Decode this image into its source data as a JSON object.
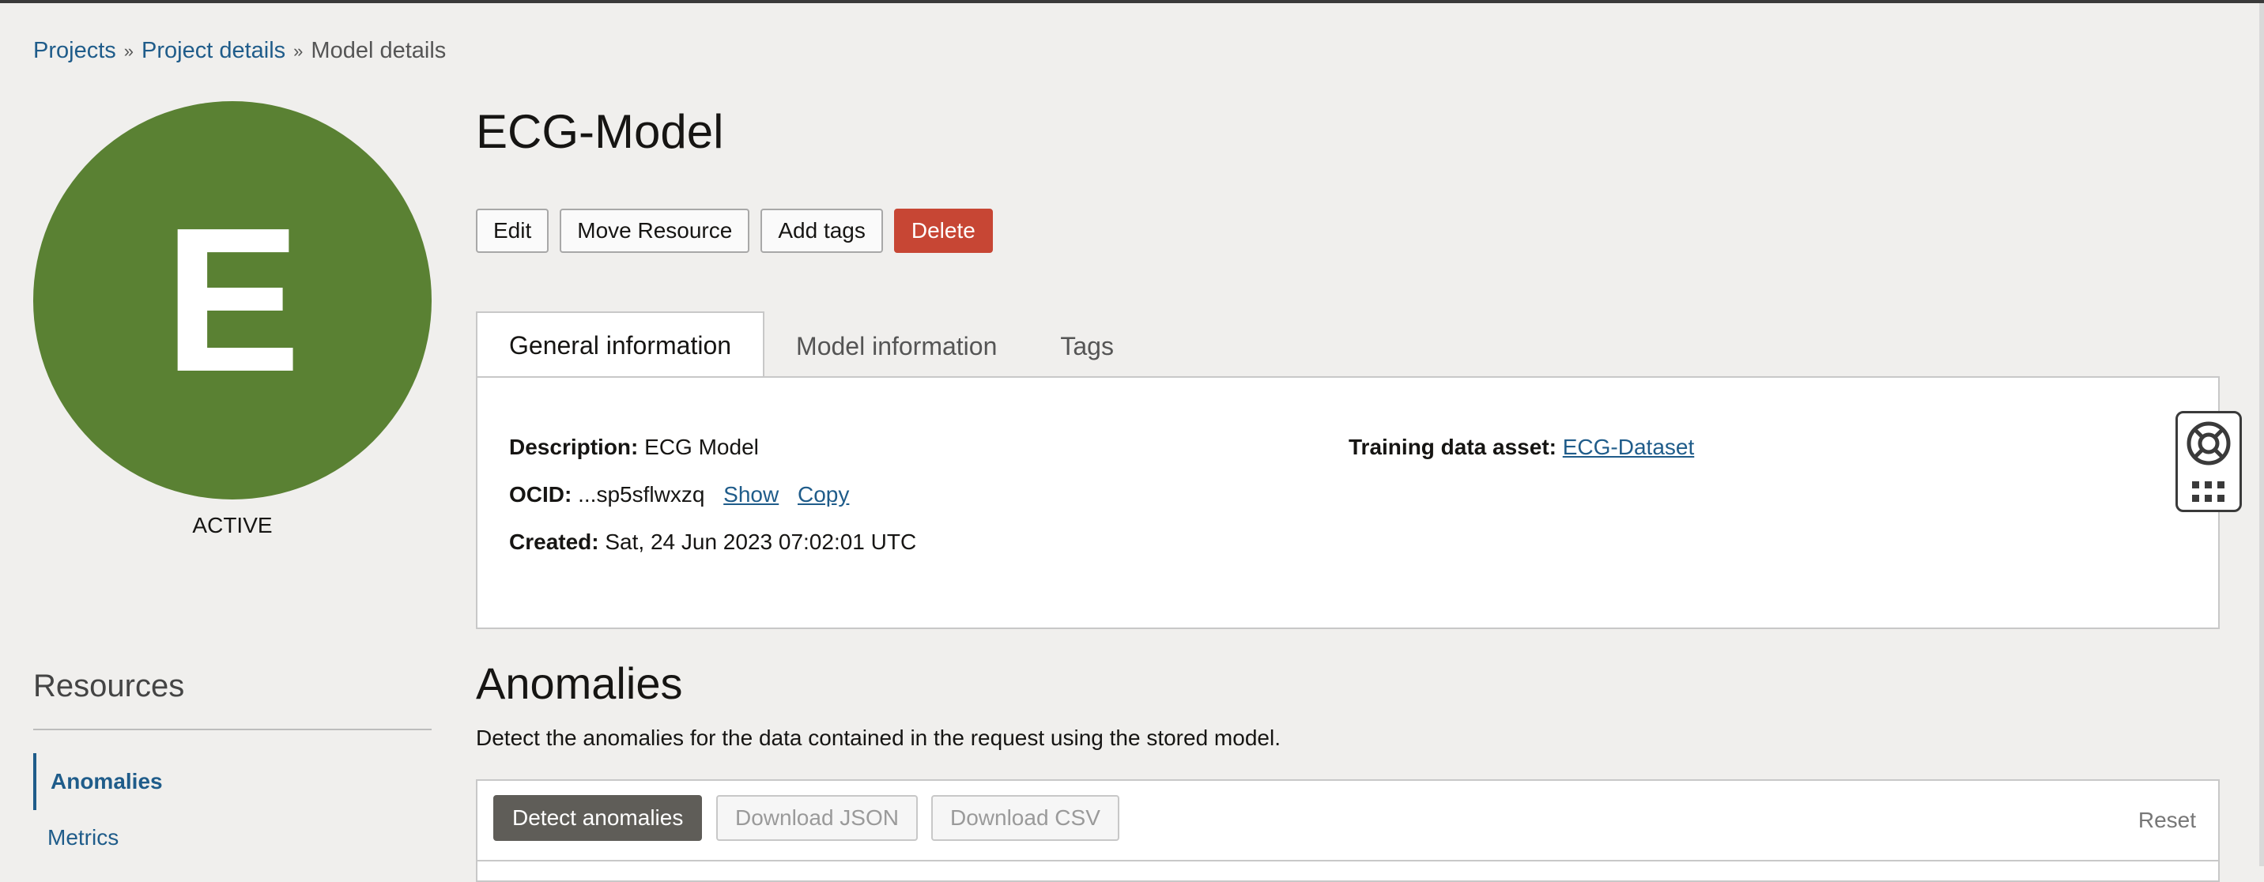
{
  "breadcrumb": {
    "projects": "Projects",
    "project_details": "Project details",
    "current": "Model details",
    "separator": "»"
  },
  "model": {
    "initial": "E",
    "name": "ECG-Model",
    "status": "ACTIVE",
    "avatar_color": "#5a8133"
  },
  "actions": {
    "edit": "Edit",
    "move": "Move Resource",
    "add_tags": "Add tags",
    "delete": "Delete"
  },
  "tabs": {
    "general": "General information",
    "model": "Model information",
    "tags": "Tags"
  },
  "general": {
    "description_label": "Description:",
    "description_value": "ECG Model",
    "ocid_label": "OCID:",
    "ocid_value": "...sp5sflwxzq",
    "show": "Show",
    "copy": "Copy",
    "created_label": "Created:",
    "created_value": "Sat, 24 Jun 2023 07:02:01 UTC",
    "training_label": "Training data asset:",
    "training_value": "ECG-Dataset"
  },
  "resources": {
    "title": "Resources",
    "items": [
      "Anomalies",
      "Metrics"
    ]
  },
  "anomalies": {
    "title": "Anomalies",
    "description": "Detect the anomalies for the data contained in the request using the stored model.",
    "detect": "Detect anomalies",
    "download_json": "Download JSON",
    "download_csv": "Download CSV",
    "reset": "Reset"
  },
  "colors": {
    "link": "#1f5c8a",
    "danger": "#c74634",
    "primary": "#5f5d58"
  },
  "icons": {
    "help": "lifebuoy-icon",
    "apps": "apps-grid-icon"
  }
}
